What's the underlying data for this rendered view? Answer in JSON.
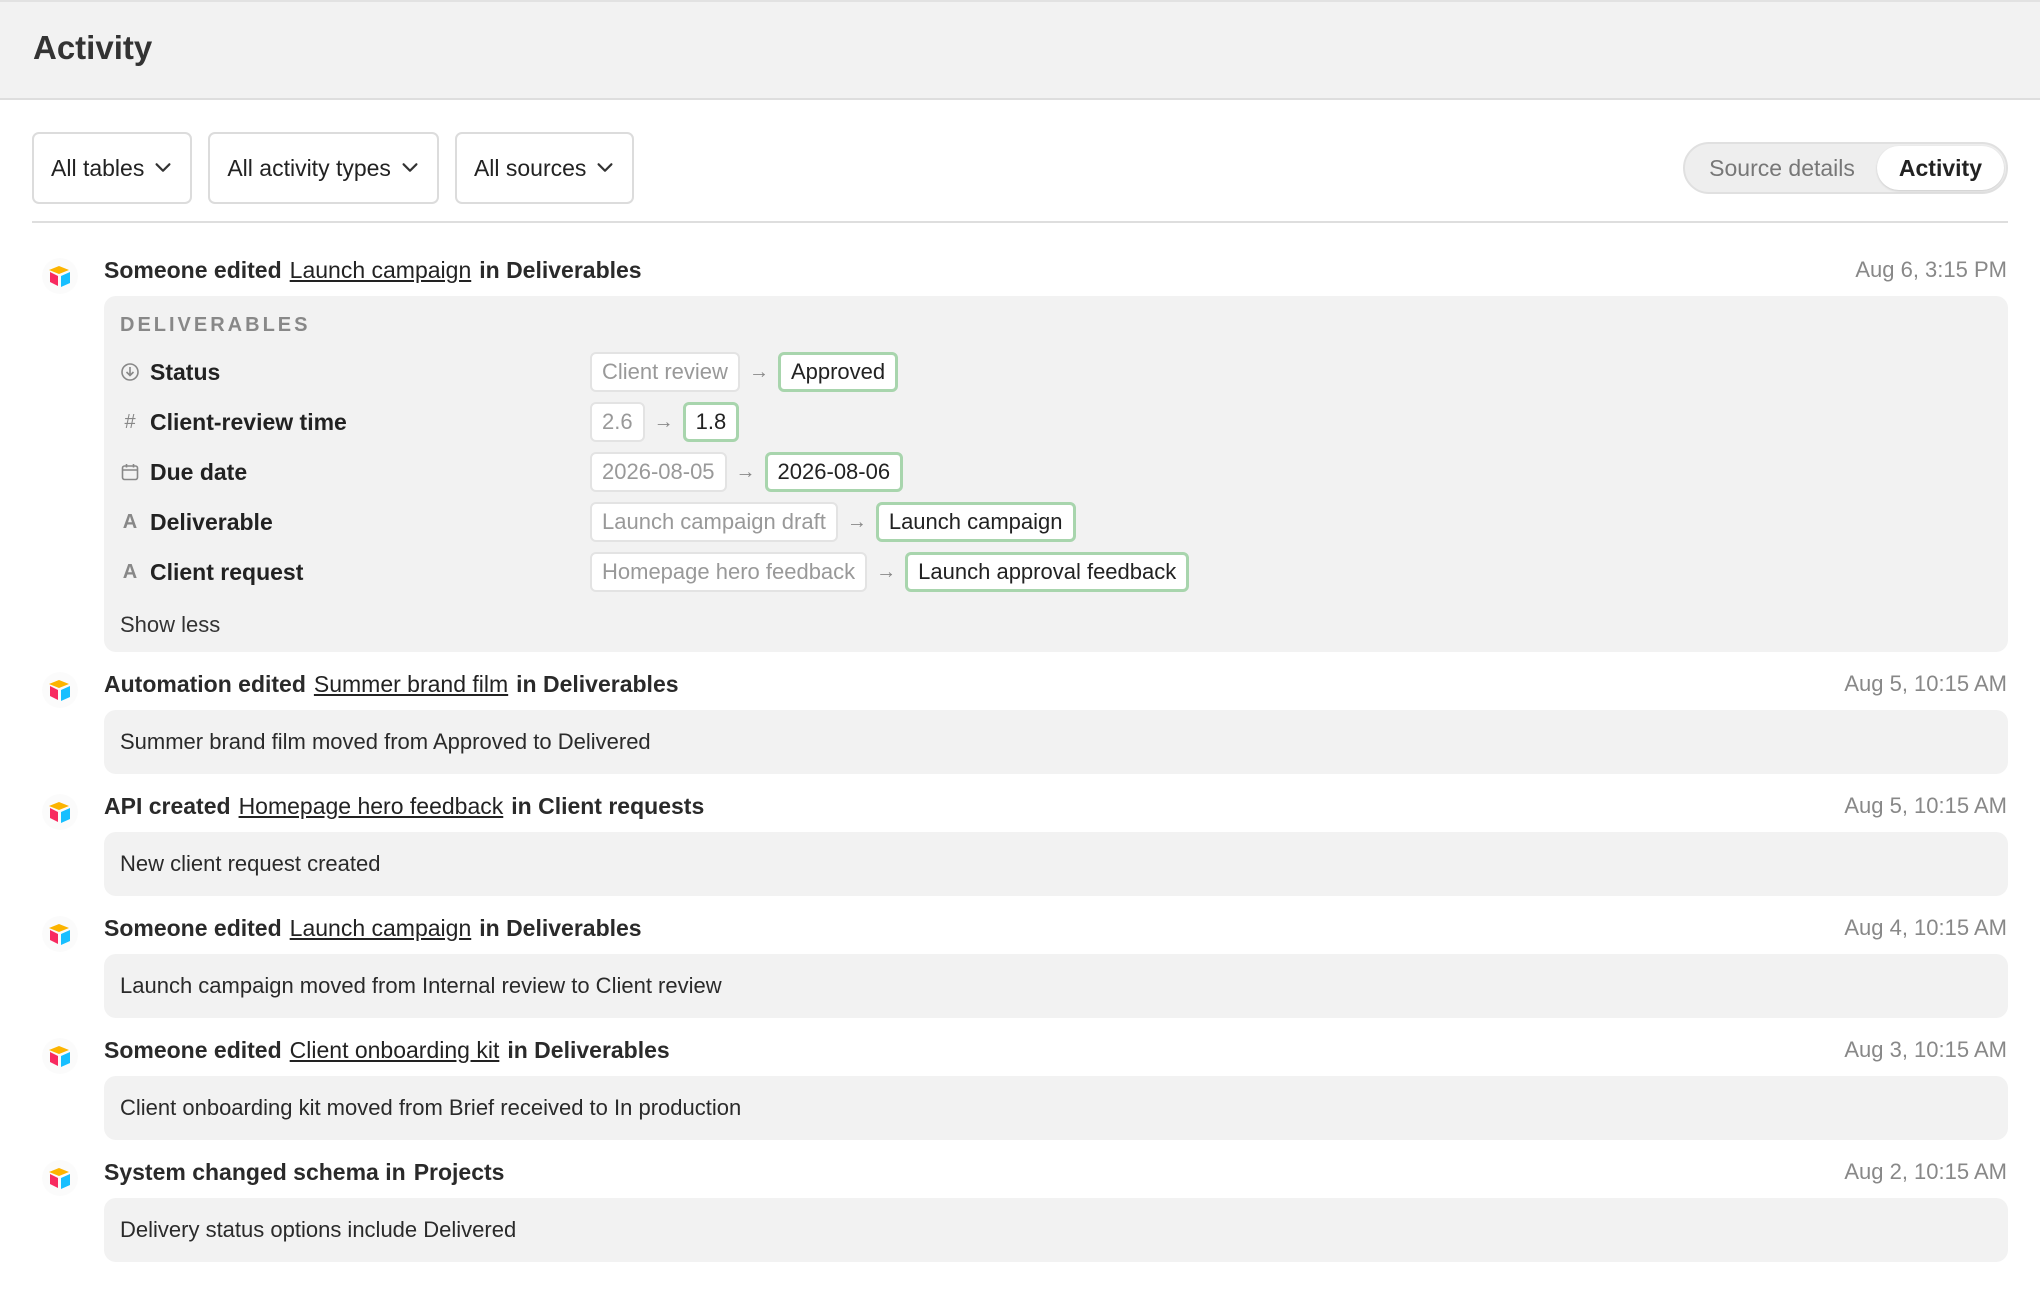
{
  "header": {
    "title": "Activity"
  },
  "filters": [
    {
      "label": "All tables"
    },
    {
      "label": "All activity types"
    },
    {
      "label": "All sources"
    }
  ],
  "view_toggle": {
    "options": [
      "Source details",
      "Activity"
    ],
    "active": "Activity"
  },
  "entries": [
    {
      "actor": "Someone edited",
      "record": "Launch campaign",
      "suffix": "in Deliverables",
      "time": "Aug 6, 3:15 PM",
      "detail": {
        "section": "DELIVERABLES",
        "fields": [
          {
            "icon": "status-icon",
            "name": "Status",
            "old": "Client review",
            "new": "Approved"
          },
          {
            "icon": "number-icon",
            "name": "Client-review time",
            "old": "2.6",
            "new": "1.8"
          },
          {
            "icon": "calendar-icon",
            "name": "Due date",
            "old": "2026-08-05",
            "new": "2026-08-06"
          },
          {
            "icon": "text-icon",
            "name": "Deliverable",
            "old": "Launch campaign draft",
            "new": "Launch campaign"
          },
          {
            "icon": "text-icon",
            "name": "Client request",
            "old": "Homepage hero feedback",
            "new": "Launch approval feedback"
          }
        ],
        "show_less": "Show less"
      }
    },
    {
      "actor": "Automation edited",
      "record": "Summer brand film",
      "suffix": "in Deliverables",
      "time": "Aug 5, 10:15 AM",
      "summary": "Summer brand film moved from Approved to Delivered"
    },
    {
      "actor": "API created",
      "record": "Homepage hero feedback",
      "suffix": "in Client requests",
      "time": "Aug 5, 10:15 AM",
      "summary": "New client request created"
    },
    {
      "actor": "Someone edited",
      "record": "Launch campaign",
      "suffix": "in Deliverables",
      "time": "Aug 4, 10:15 AM",
      "summary": "Launch campaign moved from Internal review to Client review"
    },
    {
      "actor": "Someone edited",
      "record": "Client onboarding kit",
      "suffix": "in Deliverables",
      "time": "Aug 3, 10:15 AM",
      "summary": "Client onboarding kit moved from Brief received to In production"
    },
    {
      "actor": "System changed schema in",
      "record": "",
      "suffix": "Projects",
      "time": "Aug 2, 10:15 AM",
      "summary": "Delivery status options include Delivered"
    }
  ],
  "colors": {
    "new_value_border": "#a8d5ad",
    "panel_bg": "#f2f2f2",
    "header_bg": "#f2f2f2"
  }
}
